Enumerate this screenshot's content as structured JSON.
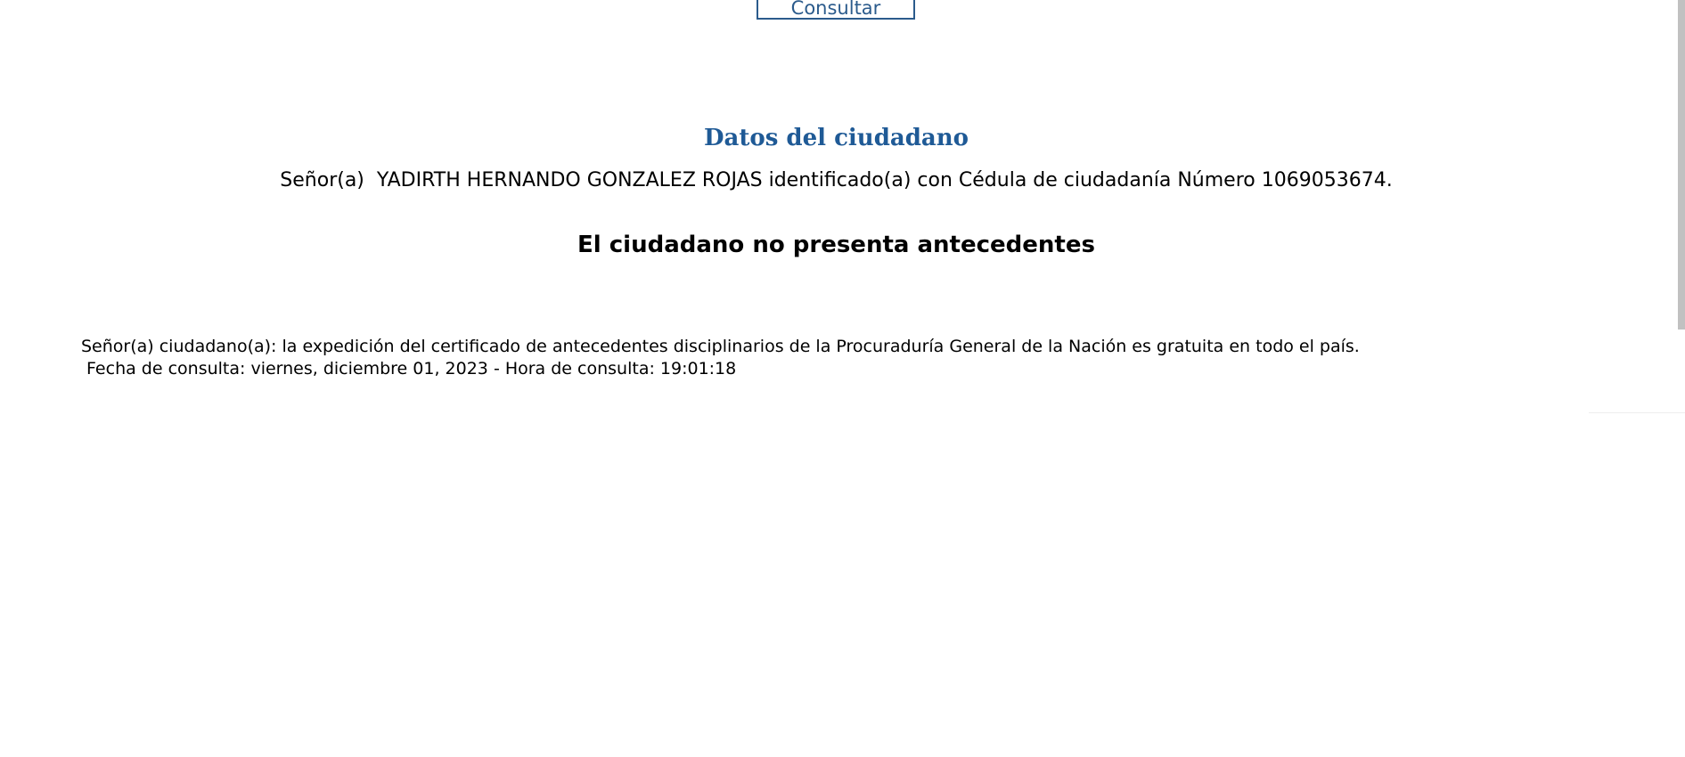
{
  "toolbar": {
    "consultar_label": "Consultar"
  },
  "citizen": {
    "section_title": "Datos del ciudadano",
    "prefix": "Señor(a)",
    "name": "YADIRTH HERNANDO GONZALEZ ROJAS",
    "id_text": "identificado(a) con Cédula de ciudadanía Número 1069053674."
  },
  "result": {
    "heading": "El ciudadano no presenta antecedentes"
  },
  "notice": {
    "line1": "Señor(a) ciudadano(a): la expedición del certificado de antecedentes disciplinarios de la Procuraduría General de la Nación es gratuita en todo el país.",
    "line2": " Fecha de consulta: viernes, diciembre 01, 2023 - Hora de consulta: 19:01:18"
  }
}
